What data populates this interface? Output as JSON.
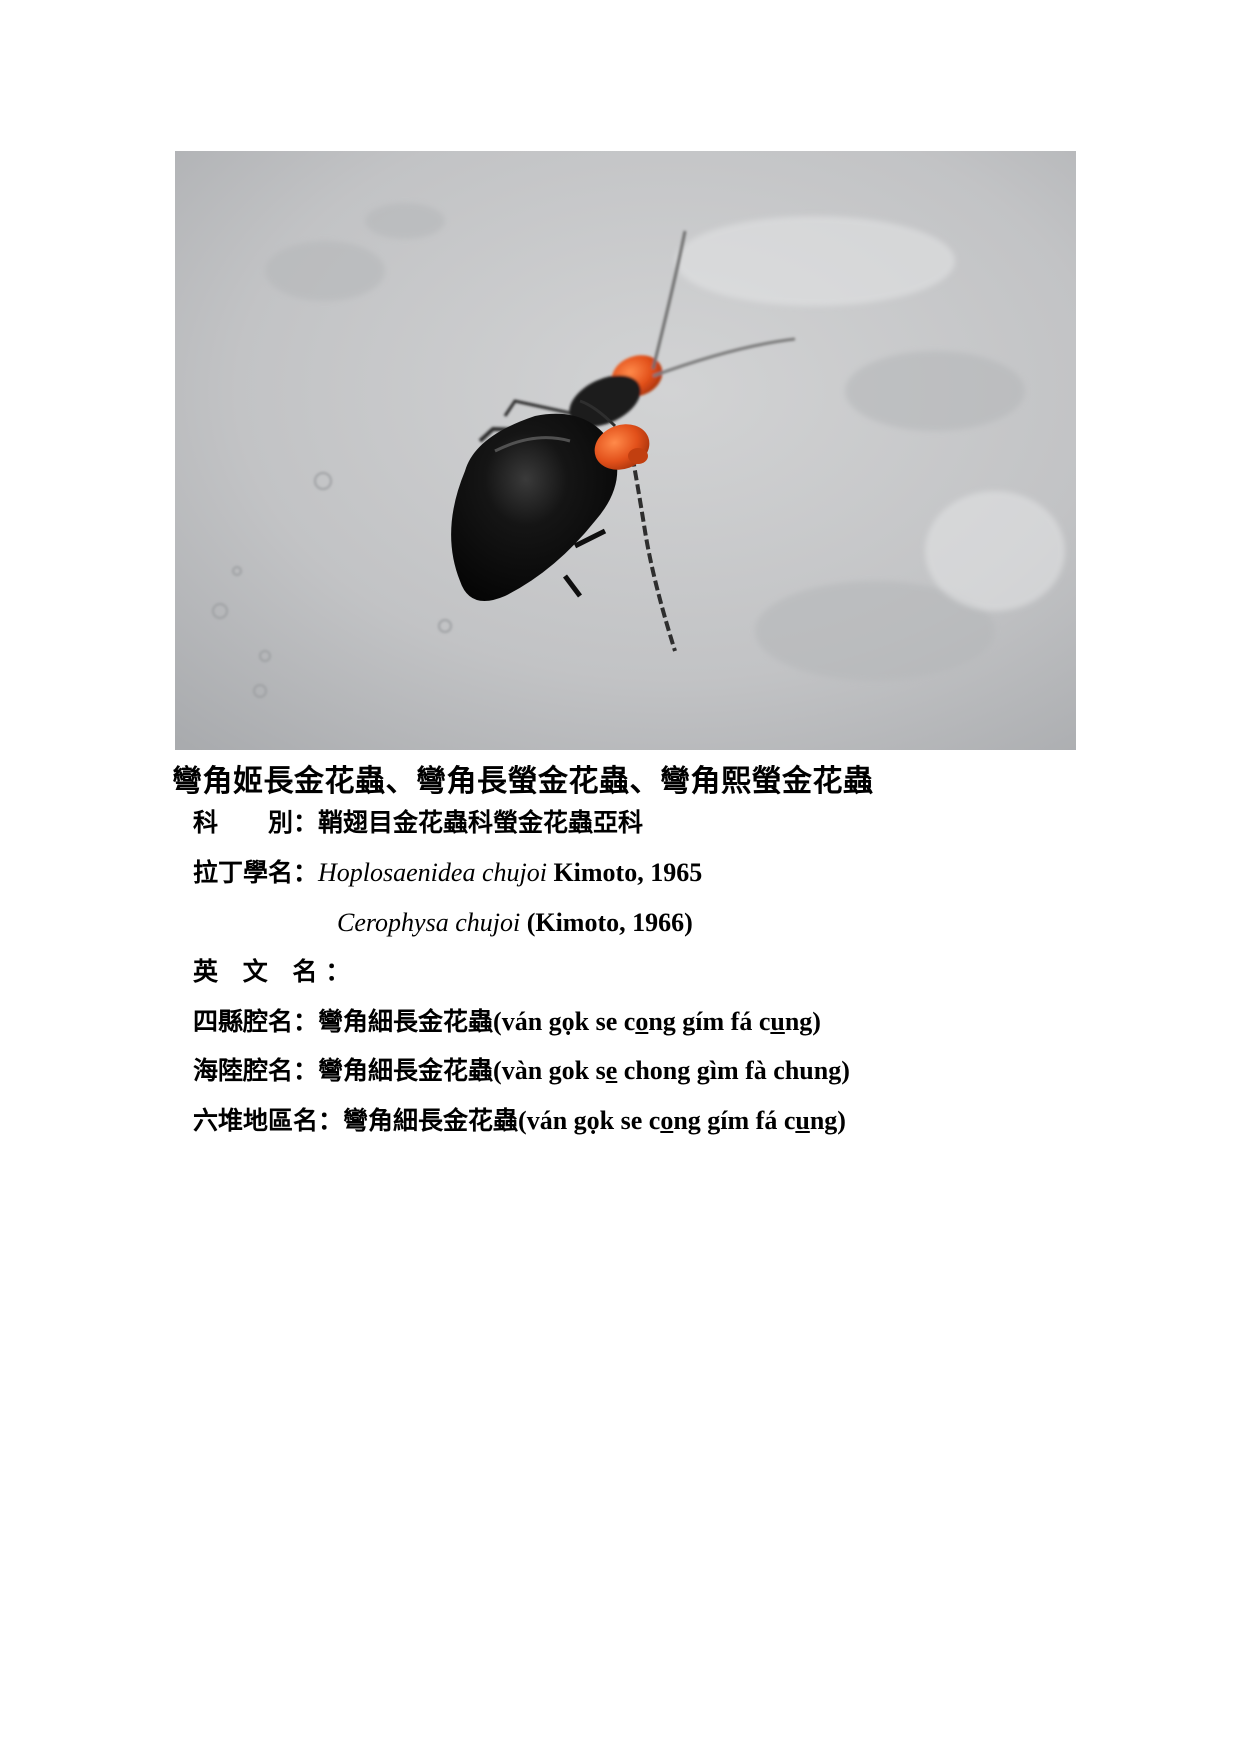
{
  "photo": {
    "subject": "beetle-photo",
    "colors": {
      "background": "#c4c5c6",
      "elytra": "#111111",
      "pronotum": "#e8581a"
    }
  },
  "title": "彎角姬長金花蟲、彎角長螢金花蟲、彎角熙螢金花蟲",
  "family": {
    "label": "科　　別：",
    "value": "鞘翅目金花蟲科螢金花蟲亞科"
  },
  "latin_name": {
    "label": "拉丁學名：",
    "name1_italic": "Hoplosaenidea chujoi",
    "name1_author": " Kimoto, 1965",
    "name2_italic": "Cerophysa chujoi",
    "name2_author": " (Kimoto, 1966)"
  },
  "english_name": {
    "label": "英 文 名：",
    "value": ""
  },
  "sixian": {
    "label": "四縣腔名：",
    "hanzi": "彎角細長金花蟲",
    "p1": "(ván gọk se c",
    "p2": "o",
    "p3": "ng gím fá c",
    "p4": "u",
    "p5": "ng)"
  },
  "hailu": {
    "label": "海陸腔名：",
    "hanzi": "彎角細長金花蟲",
    "p1": "(vàn gok s",
    "p2": "e",
    "p3": " chong gìm fà chung)"
  },
  "liudui": {
    "label": "六堆地區名：",
    "hanzi": "彎角細長金花蟲",
    "p1": "(ván gọk se c",
    "p2": "o",
    "p3": "ng gím fá c",
    "p4": "u",
    "p5": "ng)"
  }
}
